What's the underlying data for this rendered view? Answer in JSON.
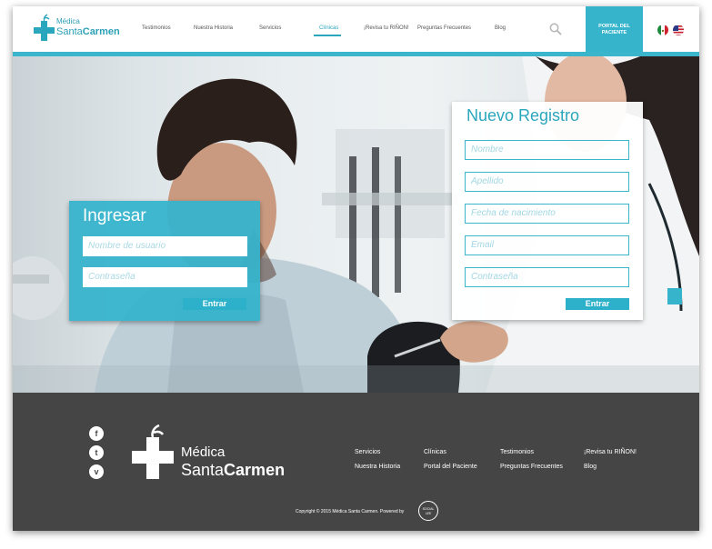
{
  "brand": {
    "line1": "Médica",
    "line2_regular": "Santa",
    "line2_bold": "Carmen",
    "color": "#2aa6bd"
  },
  "nav": {
    "items": [
      {
        "label": "Testimonios"
      },
      {
        "label": "Nuestra Historia"
      },
      {
        "label": "Servicios"
      },
      {
        "label": "Clínicas",
        "active": true
      },
      {
        "label": "¡Revisa tu RIÑON!"
      },
      {
        "label": "Preguntas Frecuentes"
      },
      {
        "label": "Blog"
      }
    ],
    "portal_line1": "PORTAL DEL",
    "portal_line2": "PACIENTE",
    "search_icon": "search-icon",
    "flags": [
      "mexico-flag-icon",
      "usa-flag-icon"
    ]
  },
  "login": {
    "title": "Ingresar",
    "username_placeholder": "Nombre de usuario",
    "password_placeholder": "Contraseña",
    "submit_label": "Entrar"
  },
  "register": {
    "title": "Nuevo Registro",
    "first_name_placeholder": "Nombre",
    "last_name_placeholder": "Apellido",
    "birthdate_placeholder": "Fecha de nacimiento",
    "email_placeholder": "Email",
    "password_placeholder": "Contraseña",
    "submit_label": "Entrar"
  },
  "footer": {
    "social": [
      {
        "icon": "facebook-icon",
        "glyph": "f"
      },
      {
        "icon": "twitter-icon",
        "glyph": "t"
      },
      {
        "icon": "vimeo-icon",
        "glyph": "v"
      }
    ],
    "logo_line1": "Médica",
    "logo_line2_regular": "Santa",
    "logo_line2_bold": "Carmen",
    "links_col1": [
      "Servicios",
      "Nuestra Historia"
    ],
    "links_col2": [
      "Clínicas",
      "Portal del Paciente"
    ],
    "links_col3": [
      "Testimonios",
      "Preguntas Frecuentes"
    ],
    "links_col4": [
      "¡Revisa tu RIÑON!",
      "Blog"
    ],
    "copyright": "Copyright © 2015 Médica Santa Carmen. Powered by",
    "powered_badge": "SOCIAL LEE"
  },
  "colors": {
    "accent": "#35b4cc",
    "footer_bg": "#454545"
  }
}
